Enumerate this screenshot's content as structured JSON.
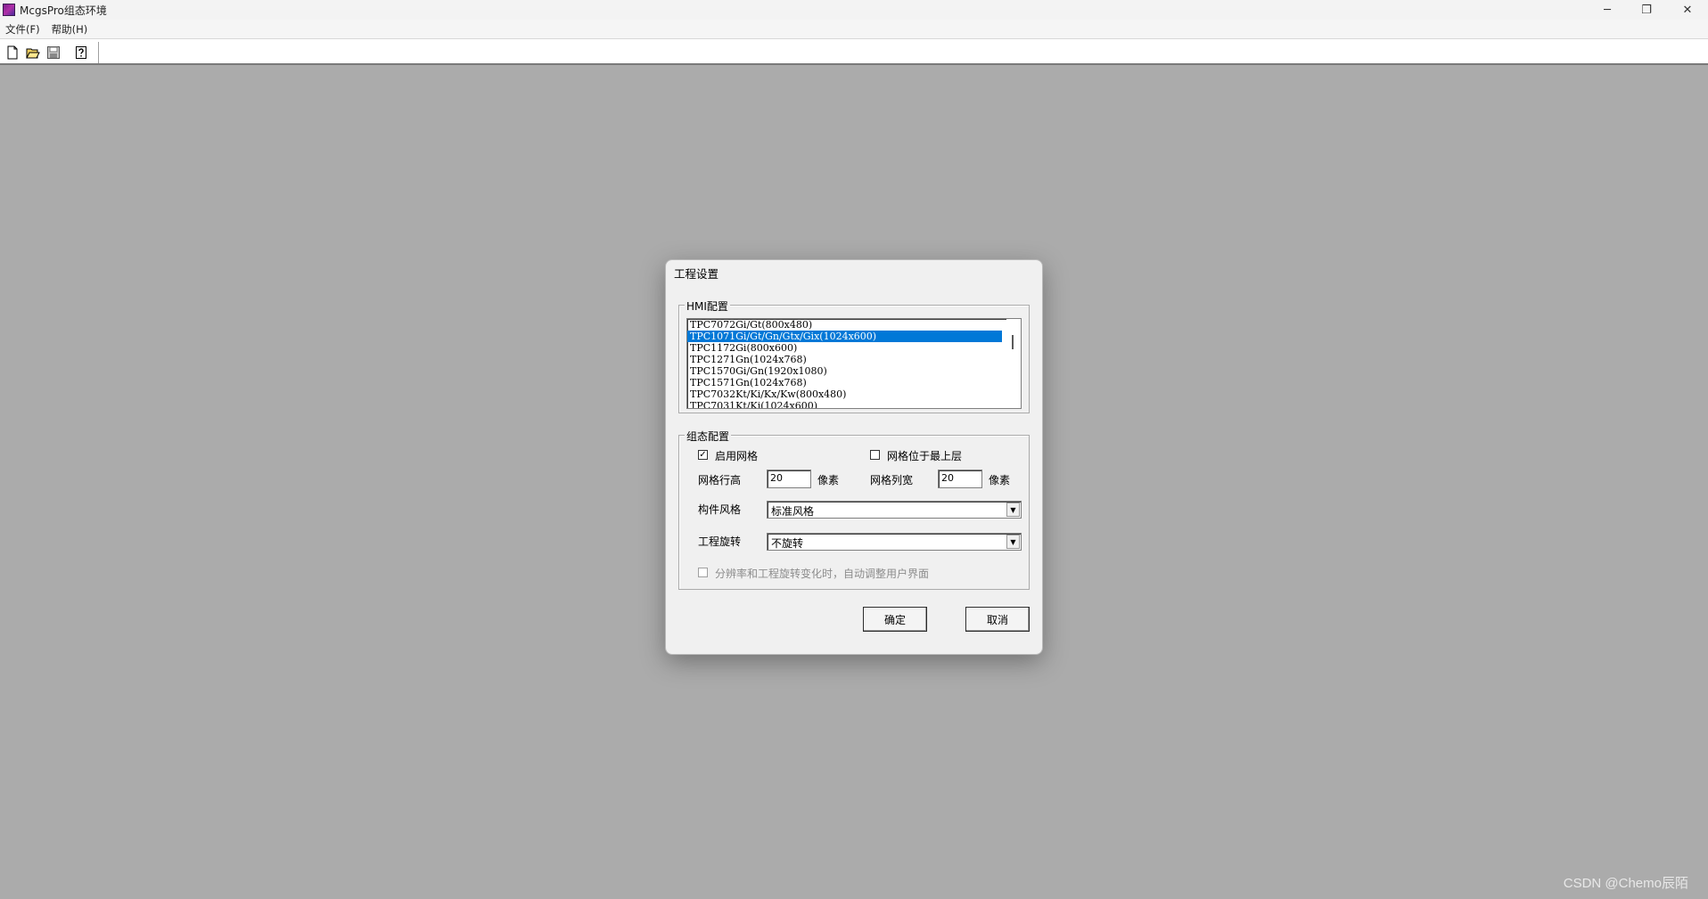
{
  "window": {
    "title": "McgsPro组态环境",
    "minimize_glyph": "─",
    "restore_glyph": "❐",
    "close_glyph": "✕"
  },
  "menu": {
    "items": [
      "文件(F)",
      "帮助(H)"
    ]
  },
  "toolbar": {
    "buttons": [
      "new-file-icon",
      "open-folder-icon",
      "save-disk-icon",
      "help-icon"
    ]
  },
  "dialog": {
    "title": "工程设置",
    "hmi_group": {
      "legend": "HMI配置",
      "items": [
        "TPC7072Gi/Gt(800x480)",
        "TPC1071Gi/Gt/Gn/Gtx/Gix(1024x600)",
        "TPC1172Gi(800x600)",
        "TPC1271Gn(1024x768)",
        "TPC1570Gi/Gn(1920x1080)",
        "TPC1571Gn(1024x768)",
        "TPC7032Kt/Ki/Kx/Kw(800x480)",
        "TPC7031Kt/Ki(1024x600)"
      ],
      "selected_index": 1
    },
    "config_group": {
      "legend": "组态配置",
      "enable_grid_label": "启用网格",
      "enable_grid_checked": true,
      "grid_on_top_label": "网格位于最上层",
      "grid_on_top_checked": false,
      "row_height_label": "网格行高",
      "row_height_value": "20",
      "row_height_unit": "像素",
      "col_width_label": "网格列宽",
      "col_width_value": "20",
      "col_width_unit": "像素",
      "style_label": "构件风格",
      "style_value": "标准风格",
      "rotation_label": "工程旋转",
      "rotation_value": "不旋转",
      "auto_adjust_label": "分辨率和工程旋转变化时，自动调整用户界面",
      "auto_adjust_checked": false
    },
    "ok_label": "确定",
    "cancel_label": "取消"
  },
  "watermark": "CSDN @Chemo辰陌"
}
